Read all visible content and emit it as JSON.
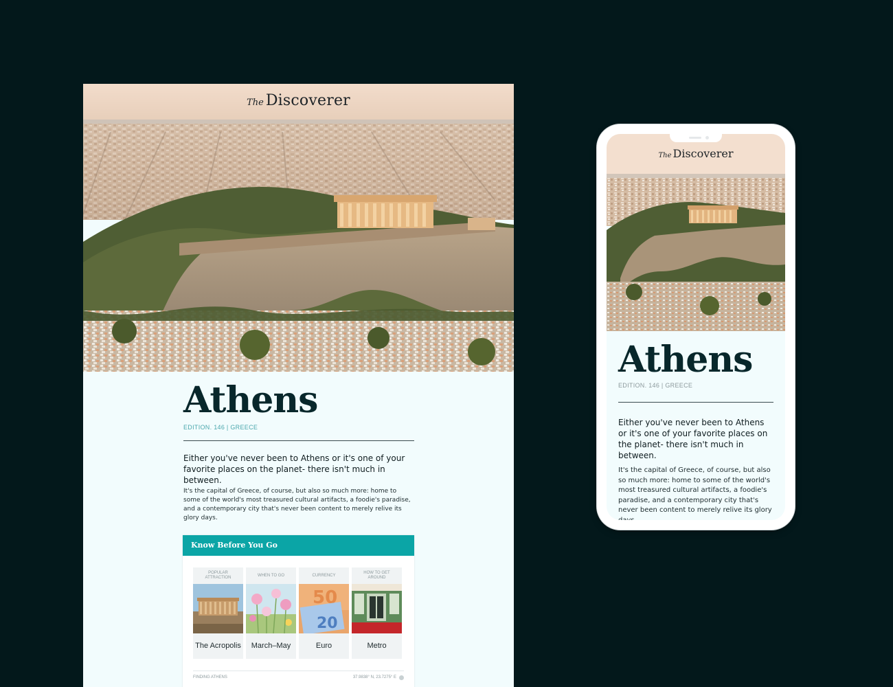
{
  "masthead": {
    "prefix": "The",
    "name": "Discoverer"
  },
  "article": {
    "title": "Athens",
    "edition": "EDITION. 146 | GREECE",
    "lead": "Either you've never been to Athens or it's one of your favorite places on the planet- there isn't much in between.",
    "body": "It's the capital of Greece, of course, but also so much more: home to some of the world's most treasured cultural artifacts, a foodie's paradise, and a contemporary city that's never been content to merely relive its glory days."
  },
  "know_before": {
    "heading": "Know Before You Go",
    "cards": [
      {
        "caption": "POPULAR ATTRACTION",
        "label": "The Acropolis",
        "image": "acropolis-photo"
      },
      {
        "caption": "WHEN TO GO",
        "label": "March–May",
        "image": "flowers-photo"
      },
      {
        "caption": "CURRENCY",
        "label": "Euro",
        "image": "euro-banknotes-photo"
      },
      {
        "caption": "HOW TO GET AROUND",
        "label": "Metro",
        "image": "metro-train-photo"
      }
    ],
    "finding_label": "FINDING ATHENS",
    "coords": "37.9838° N, 23.7275° E"
  },
  "colors": {
    "background": "#03181b",
    "page": "#f2fcfd",
    "accent_teal": "#0ba5a6",
    "title": "#08272b"
  }
}
